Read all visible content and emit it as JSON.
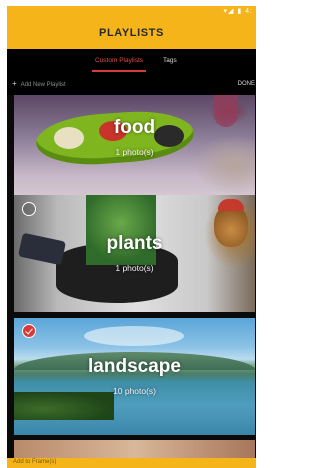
{
  "status_bar": {
    "icons": "▾◢ ▮ 4:"
  },
  "header": {
    "title": "PLAYLISTS"
  },
  "tabs": [
    {
      "label": "Custom Playlists",
      "active": true
    },
    {
      "label": "Tags",
      "active": false
    }
  ],
  "actions": {
    "add_new": "Add New Playlist",
    "done": "DONE"
  },
  "playlists": [
    {
      "name": "food",
      "count": "1 photo(s)",
      "selected": null
    },
    {
      "name": "plants",
      "count": "1 photo(s)",
      "selected": false
    },
    {
      "name": "landscape",
      "count": "10 photo(s)",
      "selected": true
    }
  ],
  "bottom_bar": {
    "label": "Add to Frame(s)"
  },
  "colors": {
    "accent": "#f4b41a",
    "tab_active": "#e34a4a",
    "check_selected": "#d83a3a"
  }
}
